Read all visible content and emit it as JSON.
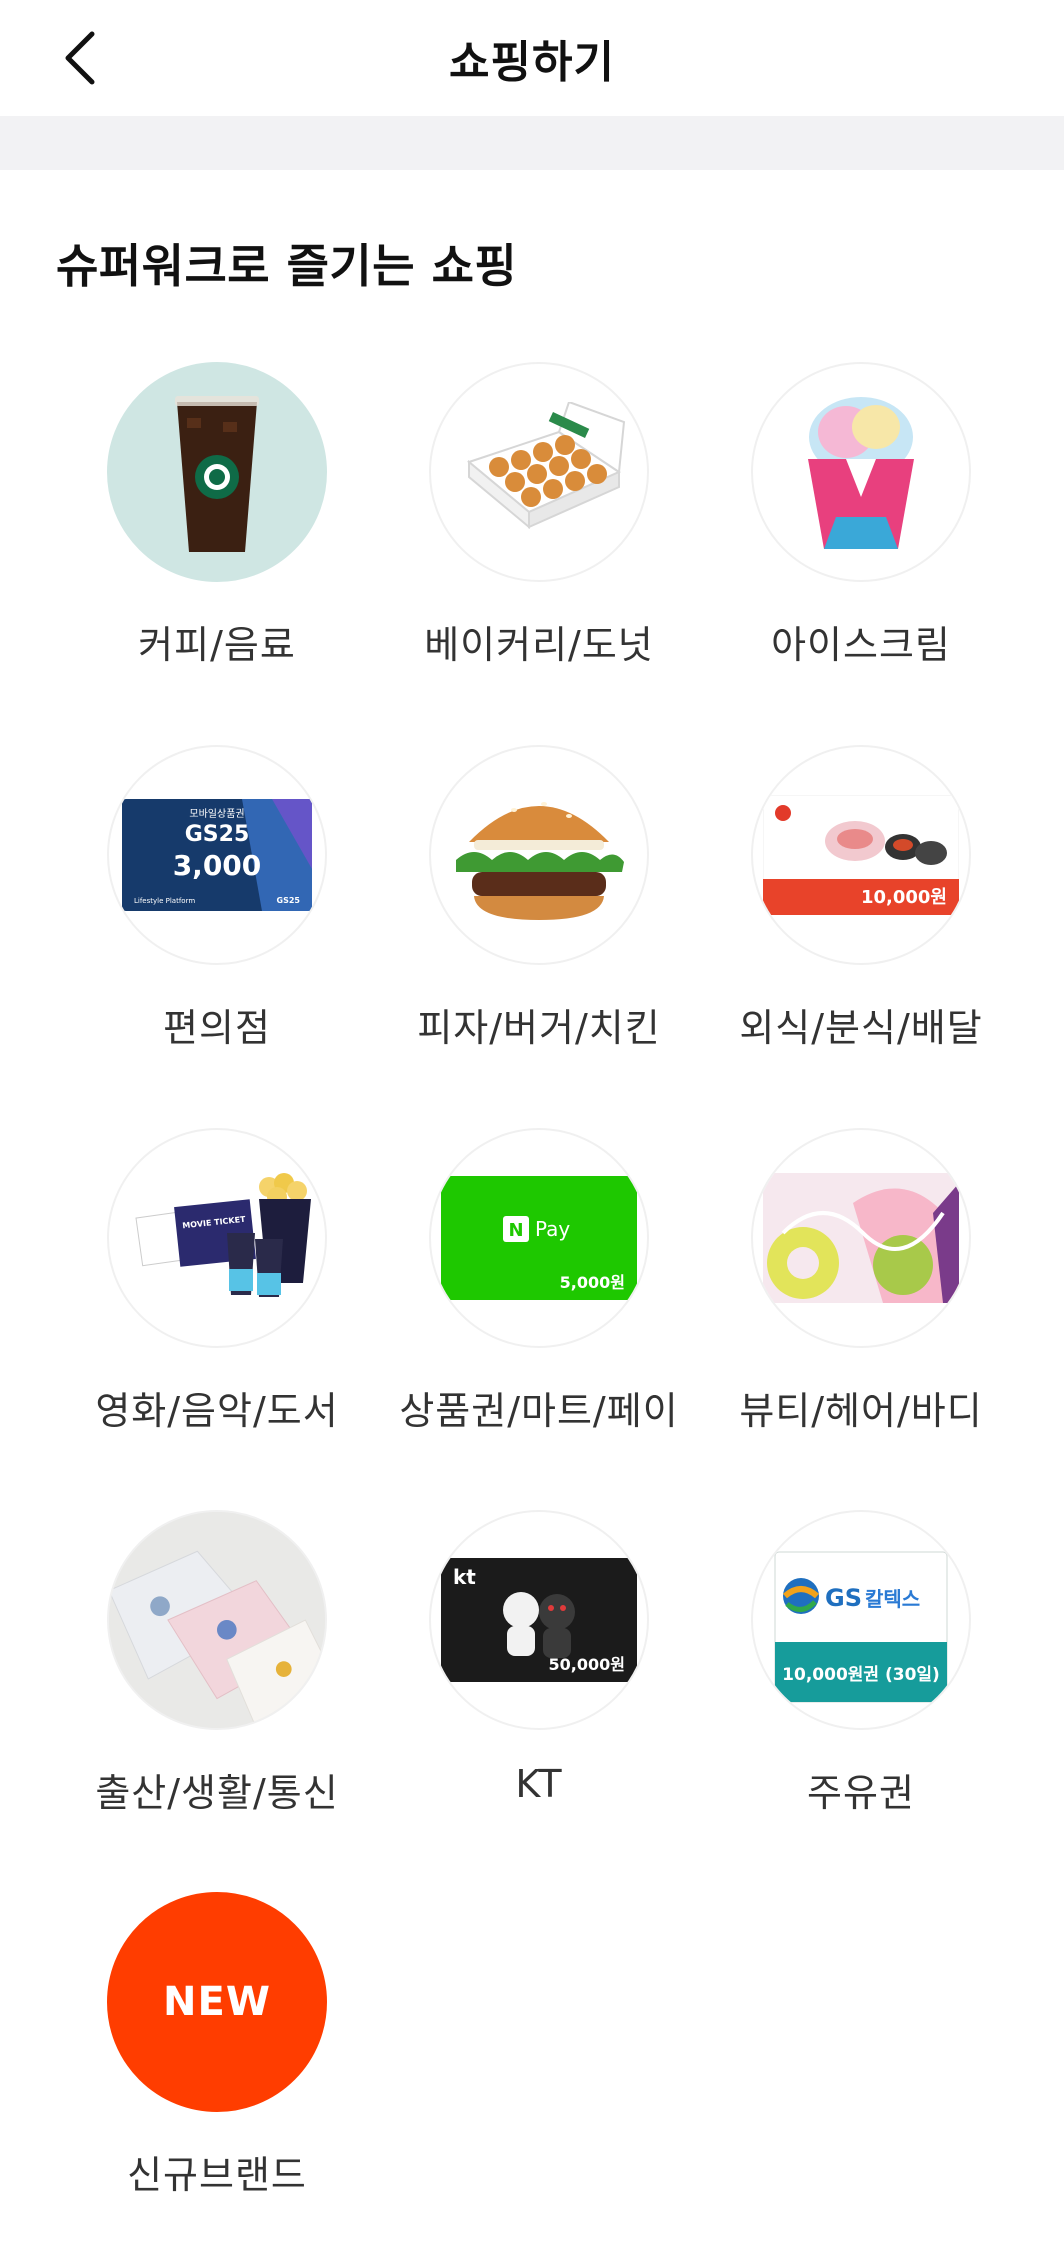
{
  "header": {
    "title": "쇼핑하기"
  },
  "section": {
    "title": "슈퍼워크로 즐기는 쇼핑"
  },
  "categories": [
    {
      "label": "커피/음료",
      "icon": "coffee-drink-icon"
    },
    {
      "label": "베이커리/도넛",
      "icon": "donut-box-icon"
    },
    {
      "label": "아이스크림",
      "icon": "ice-cream-cup-icon"
    },
    {
      "label": "편의점",
      "icon": "convenience-giftcard-icon",
      "card": {
        "top": "모바일상품권",
        "brand": "GS25",
        "amount": "3,000",
        "foot_left": "Lifestyle Platform",
        "foot_right": "GS25"
      }
    },
    {
      "label": "피자/버거/치킨",
      "icon": "burger-icon"
    },
    {
      "label": "외식/분식/배달",
      "icon": "meal-giftcard-icon",
      "card": {
        "amount": "10,000원"
      }
    },
    {
      "label": "영화/음악/도서",
      "icon": "movie-ticket-popcorn-icon",
      "card": {
        "ticket": "MOVIE TICKET"
      }
    },
    {
      "label": "상품권/마트/페이",
      "icon": "npay-giftcard-icon",
      "card": {
        "brand": "Pay",
        "amount": "5,000원"
      }
    },
    {
      "label": "뷰티/헤어/바디",
      "icon": "beauty-giftcard-icon"
    },
    {
      "label": "출산/생활/통신",
      "icon": "towels-icon"
    },
    {
      "label": "KT",
      "icon": "kt-giftcard-icon",
      "card": {
        "brand": "kt",
        "amount": "50,000원"
      }
    },
    {
      "label": "주유권",
      "icon": "gas-giftcard-icon",
      "card": {
        "brand": "GS",
        "brand_ko": "칼텍스",
        "amount": "10,000원권 (30일)"
      }
    },
    {
      "label": "신규브랜드",
      "icon": "new-badge-icon",
      "badge": "NEW"
    }
  ],
  "colors": {
    "accent_new": "#ff3d00",
    "band": "#f2f2f4",
    "label": "#333333"
  }
}
